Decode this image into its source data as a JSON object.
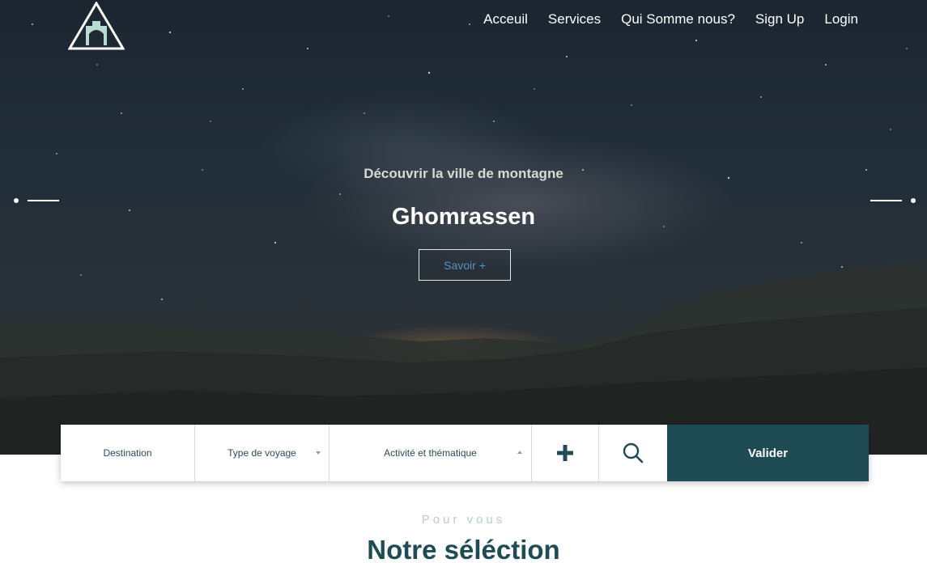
{
  "nav": {
    "items": [
      {
        "label": "Acceuil"
      },
      {
        "label": "Services"
      },
      {
        "label": "Qui Somme nous?"
      },
      {
        "label": "Sign Up"
      },
      {
        "label": "Login"
      }
    ]
  },
  "hero": {
    "subtitle": "Découvrir la ville de montagne",
    "title": "Ghomrassen",
    "button_label": "Savoir +"
  },
  "search": {
    "destination_label": "Destination",
    "type_label": "Type de voyage",
    "activity_label": "Activité et thématique",
    "submit_label": "Valider"
  },
  "section": {
    "kicker": "Pour vous",
    "title": "Notre séléction"
  },
  "colors": {
    "brand": "#1e4b54",
    "accent_light": "#b7cfcc",
    "link_blue": "#5b8fc7"
  },
  "icons": {
    "logo": "logo-triangle-icon",
    "plus": "plus-icon",
    "search": "search-icon"
  }
}
